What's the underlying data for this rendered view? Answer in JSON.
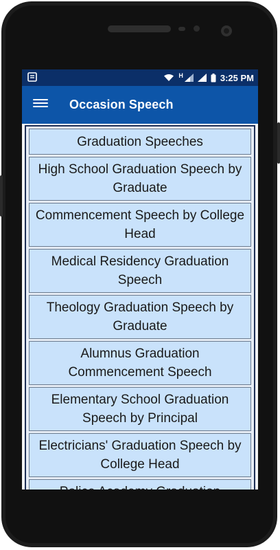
{
  "status_bar": {
    "time": "3:25 PM",
    "network_label": "H",
    "colors": {
      "background": "#0b2f68"
    }
  },
  "app_bar": {
    "title": "Occasion Speech",
    "menu_icon": "hamburger-menu-icon",
    "colors": {
      "background": "#0d55a8"
    }
  },
  "list": {
    "items": [
      "Graduation Speeches",
      "High School Graduation Speech by Graduate",
      "Commencement Speech by College Head",
      "Medical Residency Graduation Speech",
      "Theology Graduation Speech by Graduate",
      "Alumnus Graduation Commencement Speech",
      "Elementary School Graduation Speech by Principal",
      "Electricians' Graduation Speech by College Head",
      "Police Academy Graduation"
    ],
    "colors": {
      "item_background": "#c9e2fb",
      "item_border": "#6b7b8f"
    }
  }
}
